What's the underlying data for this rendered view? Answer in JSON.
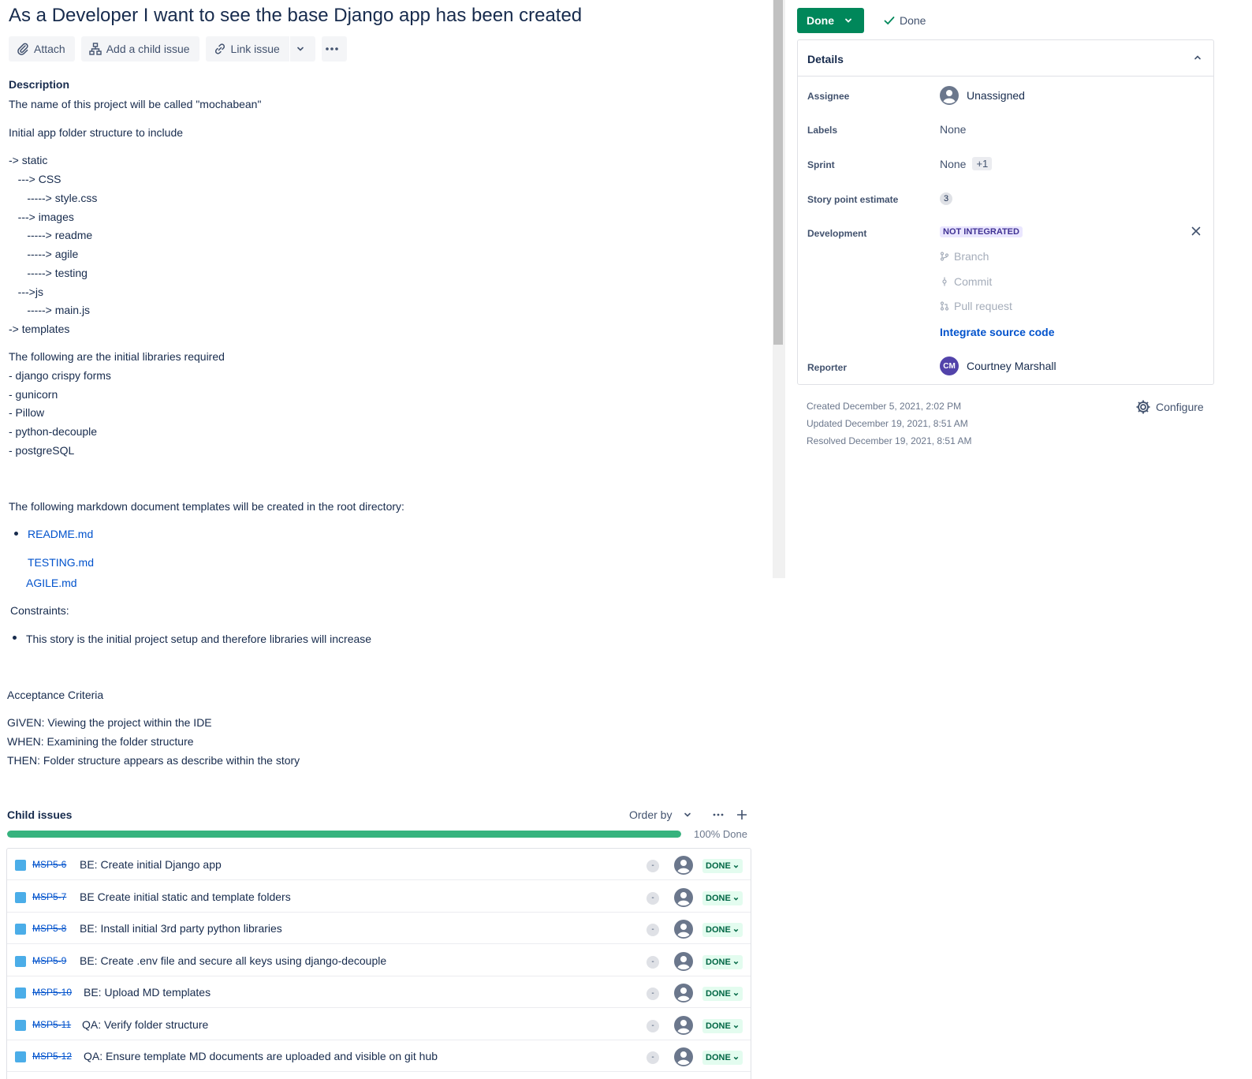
{
  "issue": {
    "title": "As a Developer I want to see the base Django app has been created"
  },
  "toolbar": {
    "attach": "Attach",
    "add_child": "Add a child issue",
    "link_issue": "Link issue"
  },
  "description": {
    "heading": "Description",
    "lines": [
      "The name of this project will be called \"mochabean\"",
      "Initial app folder structure to include",
      "-> static",
      "   ---> CSS",
      "      -----> style.css",
      "   ---> images",
      "      -----> readme",
      "      -----> agile",
      "      -----> testing",
      "   --->js",
      "      -----> main.js",
      "-> templates",
      "The following are the initial libraries required",
      "- django crispy forms",
      "- gunicorn",
      "- Pillow",
      "- python-decouple",
      "- postgreSQL",
      "The following markdown document templates will be created in the root directory:",
      "README.md",
      "TESTING.md",
      "AGILE.md",
      "Constraints:",
      "This story is the initial project setup and therefore libraries will increase",
      "Acceptance Criteria",
      "GIVEN: Viewing the project within the IDE",
      "WHEN: Examining the folder structure",
      "THEN: Folder structure appears as describe within the story"
    ]
  },
  "child_issues": {
    "title": "Child issues",
    "order_by": "Order by",
    "progress": 1.0,
    "progress_label": "100% Done",
    "rows": [
      {
        "key": "MSP5-6",
        "summary": "BE: Create initial Django app",
        "priority": "-",
        "status": "DONE"
      },
      {
        "key": "MSP5-7",
        "summary": "BE Create initial static and template folders",
        "priority": "-",
        "status": "DONE"
      },
      {
        "key": "MSP5-8",
        "summary": "BE: Install initial 3rd party python libraries",
        "priority": "-",
        "status": "DONE"
      },
      {
        "key": "MSP5-9",
        "summary": "BE: Create .env file and secure all keys using django-decouple",
        "priority": "-",
        "status": "DONE"
      },
      {
        "key": "MSP5-10",
        "summary": "BE: Upload MD templates",
        "priority": "-",
        "status": "DONE"
      },
      {
        "key": "MSP5-11",
        "summary": "QA: Verify folder structure",
        "priority": "-",
        "status": "DONE"
      },
      {
        "key": "MSP5-12",
        "summary": "QA: Ensure template MD documents are uploaded and visible on git hub",
        "priority": "-",
        "status": "DONE"
      }
    ]
  },
  "status": {
    "button": "Done",
    "resolution": "Done"
  },
  "details": {
    "heading": "Details",
    "assignee_label": "Assignee",
    "assignee": "Unassigned",
    "labels_label": "Labels",
    "labels": "None",
    "sprint_label": "Sprint",
    "sprint": "None",
    "sprint_extra": "+1",
    "story_points_label": "Story point estimate",
    "story_points": "3",
    "development_label": "Development",
    "development_status": "NOT INTEGRATED",
    "branch": "Branch",
    "commit": "Commit",
    "pull_request": "Pull request",
    "integrate": "Integrate source code",
    "reporter_label": "Reporter",
    "reporter_initials": "CM",
    "reporter": "Courtney Marshall"
  },
  "meta": {
    "created": "Created December 5, 2021, 2:02 PM",
    "updated": "Updated December 19, 2021, 8:51 AM",
    "resolved": "Resolved December 19, 2021, 8:51 AM",
    "configure": "Configure"
  },
  "colors": {
    "status_green": "#00875a",
    "progress_green": "#36b37e",
    "link_blue": "#0052cc",
    "lozenge_purple": "#403294"
  }
}
